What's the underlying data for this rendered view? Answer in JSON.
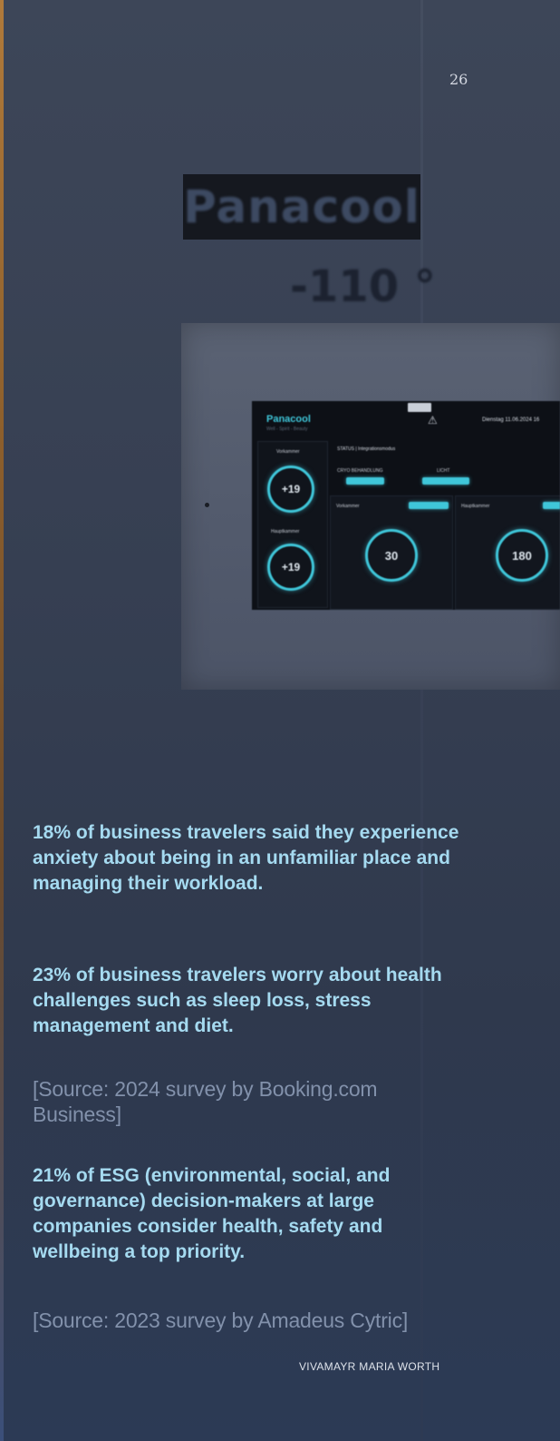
{
  "page": {
    "number": "26",
    "footer": "VIVAMAYR MARIA WORTH"
  },
  "photo": {
    "brand_sign": "Panacool",
    "temperature": "-110 °",
    "screen": {
      "logo": "Panacool",
      "logo_sub": "Well - Spirit - Beauty",
      "date": "Dienstag 11.06.2024 16",
      "side_label_1": "Vorkammer",
      "side_value_1": "+19",
      "side_label_2": "Hauptkammer",
      "side_value_2": "+19",
      "status": "STATUS  |  Integrationsmodus",
      "cryo_label": "CRYO BEHANDLUNG",
      "light_label": "LICHT",
      "card1_label": "Vorkammer",
      "card1_value": "30",
      "card2_label": "Hauptkammer",
      "card2_value": "180",
      "accent": "#3fc6d9"
    }
  },
  "content": {
    "stat1": "18% of business travelers said they experience anxiety about being in an unfamiliar place and managing their workload.",
    "stat2": "23% of business travelers worry about health challenges such as sleep loss, stress management and diet.",
    "source1": "[Source: 2024 survey by Booking.com Business]",
    "stat3": "21% of ESG (environmental, social, and governance) decision-makers at large companies consider health, safety and wellbeing a top priority.",
    "source2": "[Source: 2023 survey by Amadeus Cytric]"
  },
  "colors": {
    "stat_text": "#a5daf0",
    "source_text": "#8291ab",
    "background": "#363f52"
  }
}
